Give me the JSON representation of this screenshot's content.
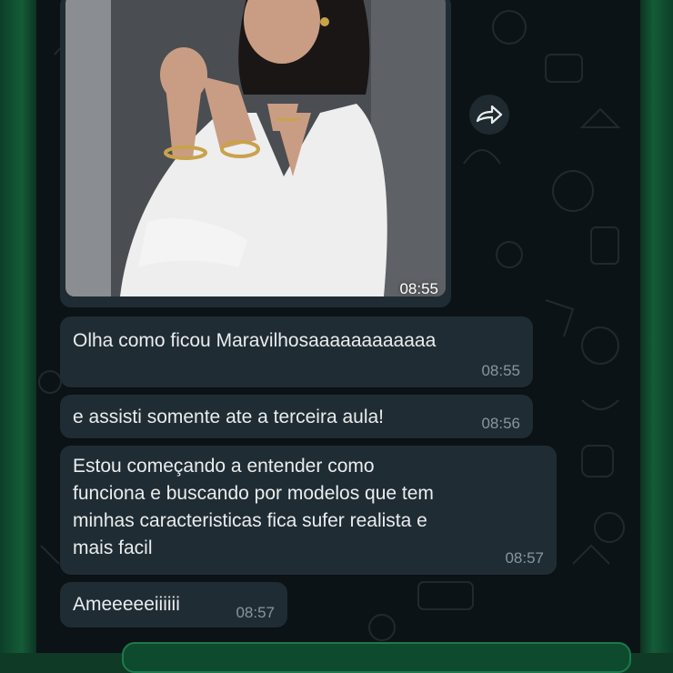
{
  "photo_message": {
    "time": "08:55"
  },
  "forward_button": {
    "icon": "forward-icon"
  },
  "messages": [
    {
      "text": "Olha como ficou Maravilhosaaaaaaaaaaaa",
      "time": "08:55"
    },
    {
      "text": "e assisti somente ate a terceira aula!",
      "time": "08:56"
    },
    {
      "text": "Estou começando a entender como\nfunciona e buscando por modelos que tem\nminhas caracteristicas fica sufer realista e\nmais facil",
      "time": "08:57"
    },
    {
      "text": "Ameeeeeiiiiii",
      "time": "08:57"
    }
  ],
  "colors": {
    "bubble": "#202c33",
    "chat_background": "#0c1317",
    "accent": "#1c7a4b"
  }
}
